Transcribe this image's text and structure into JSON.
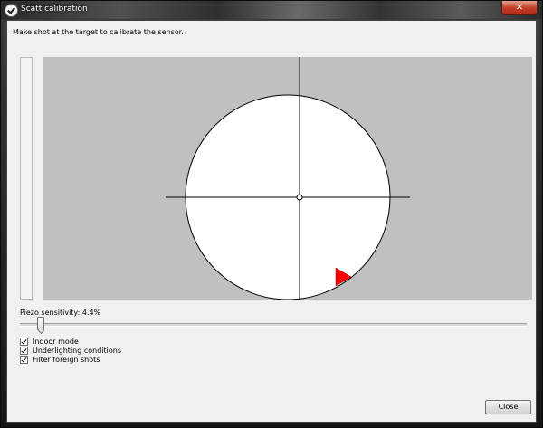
{
  "window": {
    "title": "Scatt calibration",
    "close_glyph": "✕"
  },
  "instruction": "Make shot at the target to calibrate the sensor.",
  "sensitivity": {
    "label": "Piezo sensitivity: 4.4%",
    "value_percent": 4.4
  },
  "options": [
    {
      "label": "Indoor mode",
      "checked": true
    },
    {
      "label": "Underlighting conditions",
      "checked": true
    },
    {
      "label": "Filter foreign shots",
      "checked": true
    }
  ],
  "buttons": {
    "close_label": "Close"
  },
  "colors": {
    "target_background": "#c0c0c0",
    "target_face": "#ffffff",
    "marker": "#ff0000"
  },
  "icons": {
    "app": "scatt-check-icon",
    "marker": "red-triangle-marker-icon"
  }
}
